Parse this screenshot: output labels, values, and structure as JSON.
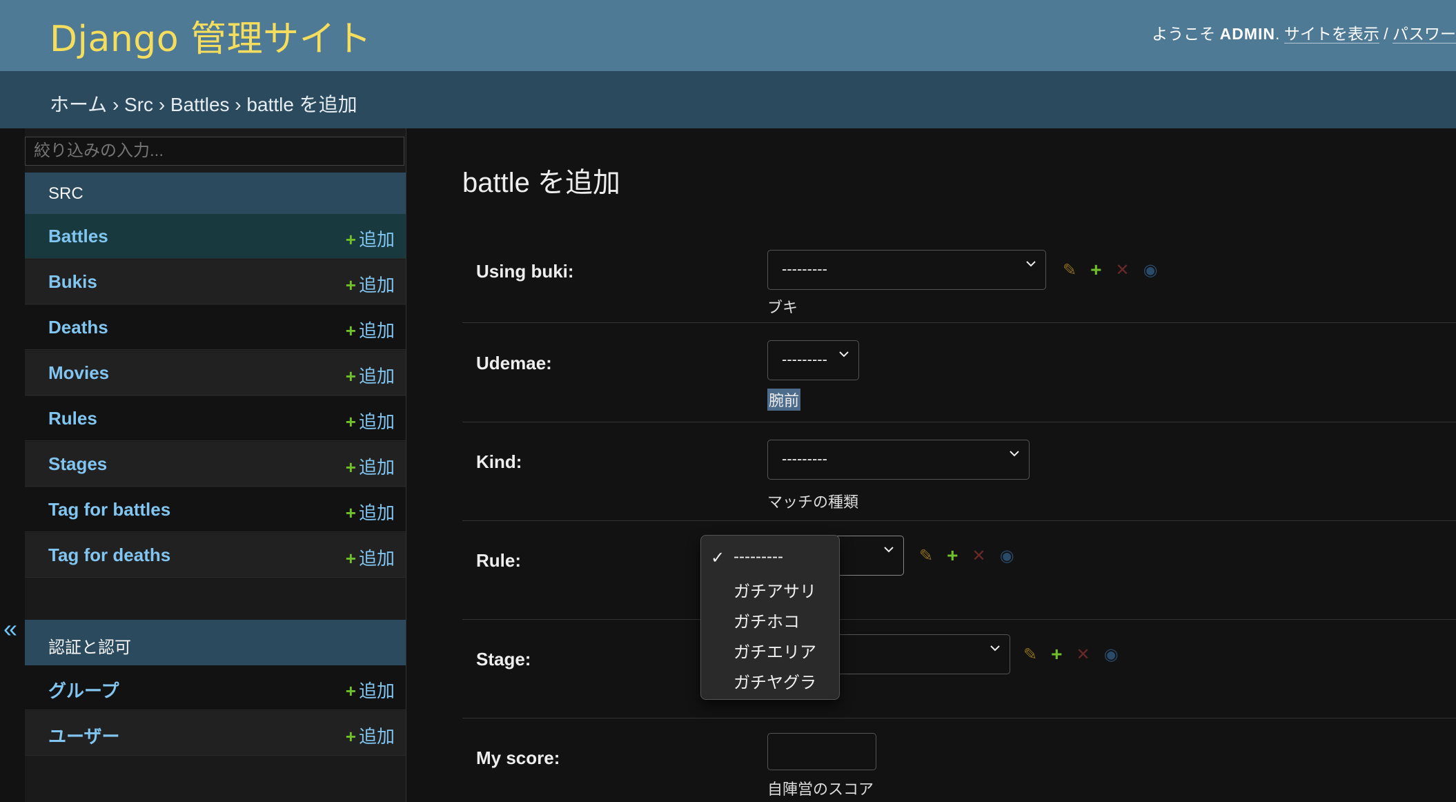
{
  "header": {
    "branding": "Django 管理サイト",
    "welcome": "ようこそ",
    "username": "ADMIN",
    "view_site": "サイトを表示",
    "separator": "/",
    "password_link": "パスワー"
  },
  "breadcrumbs": "ホーム › Src › Battles › battle を追加",
  "sidebar": {
    "filter_placeholder": "絞り込みの入力...",
    "collapse": "«",
    "apps": [
      {
        "caption": "SRC",
        "models": [
          {
            "name": "Battles",
            "add": "追加"
          },
          {
            "name": "Bukis",
            "add": "追加"
          },
          {
            "name": "Deaths",
            "add": "追加"
          },
          {
            "name": "Movies",
            "add": "追加"
          },
          {
            "name": "Rules",
            "add": "追加"
          },
          {
            "name": "Stages",
            "add": "追加"
          },
          {
            "name": "Tag for battles",
            "add": "追加"
          },
          {
            "name": "Tag for deaths",
            "add": "追加"
          }
        ]
      },
      {
        "caption": "認証と認可",
        "models": [
          {
            "name": "グループ",
            "add": "追加"
          },
          {
            "name": "ユーザー",
            "add": "追加"
          }
        ]
      }
    ]
  },
  "main": {
    "title": "battle を追加",
    "fields": {
      "using_buki": {
        "label": "Using buki:",
        "value": "---------",
        "help": "ブキ"
      },
      "udemae": {
        "label": "Udemae:",
        "value": "---------",
        "help": "腕前"
      },
      "kind": {
        "label": "Kind:",
        "value": "---------",
        "help": "マッチの種類"
      },
      "rule": {
        "label": "Rule:"
      },
      "stage": {
        "label": "Stage:"
      },
      "my_score": {
        "label": "My score:",
        "help": "自陣営のスコア"
      }
    }
  },
  "rule_dropdown": {
    "options": [
      "---------",
      "ガチアサリ",
      "ガチホコ",
      "ガチエリア",
      "ガチヤグラ"
    ],
    "selected": "---------",
    "check": "✓"
  },
  "icons": {
    "change": "pencil-icon",
    "add": "add-icon",
    "delete": "delete-icon",
    "view": "view-icon"
  }
}
